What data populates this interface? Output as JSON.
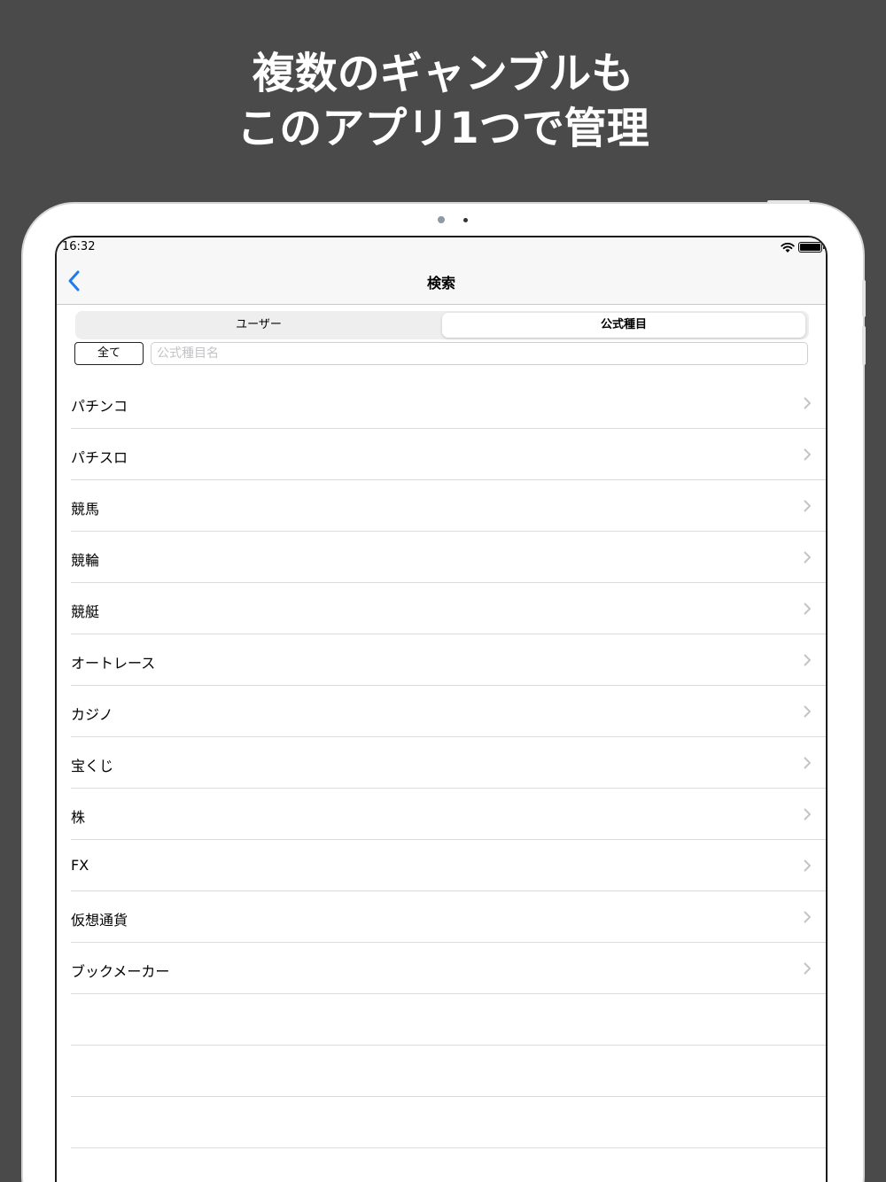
{
  "headline": {
    "line1": "複数のギャンブルも",
    "line2": "このアプリ1つで管理"
  },
  "status_bar": {
    "time": "16:32"
  },
  "nav": {
    "title": "検索"
  },
  "segments": [
    {
      "label": "ユーザー",
      "selected": false
    },
    {
      "label": "公式種目",
      "selected": true
    }
  ],
  "filter": {
    "all_label": "全て",
    "search_placeholder": "公式種目名"
  },
  "items": [
    {
      "label": "パチンコ"
    },
    {
      "label": "パチスロ"
    },
    {
      "label": "競馬"
    },
    {
      "label": "競輪"
    },
    {
      "label": "競艇"
    },
    {
      "label": "オートレース"
    },
    {
      "label": "カジノ"
    },
    {
      "label": "宝くじ"
    },
    {
      "label": "株"
    },
    {
      "label": "FX"
    },
    {
      "label": "仮想通貨"
    },
    {
      "label": "ブックメーカー"
    }
  ],
  "colors": {
    "background": "#4a4a4a",
    "accent": "#1e7cf0"
  }
}
